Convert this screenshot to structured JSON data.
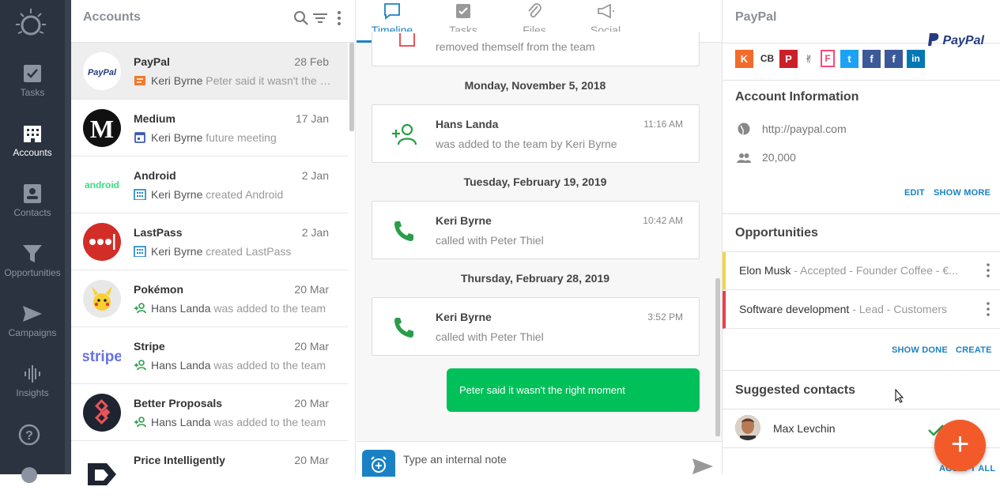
{
  "nav": {
    "items": [
      {
        "label": "Tasks",
        "icon": "checkbox-icon"
      },
      {
        "label": "Accounts",
        "icon": "building-icon"
      },
      {
        "label": "Contacts",
        "icon": "contact-card-icon"
      },
      {
        "label": "Opportunities",
        "icon": "funnel-icon"
      },
      {
        "label": "Campaigns",
        "icon": "paper-plane-icon"
      },
      {
        "label": "Insights",
        "icon": "waveform-icon"
      }
    ]
  },
  "list": {
    "title": "Accounts",
    "rows": [
      {
        "name": "PayPal",
        "date": "28 Feb",
        "who": "Keri Byrne",
        "text": "Peter said it wasn't the right moment",
        "icon": "note-icon"
      },
      {
        "name": "Medium",
        "date": "17 Jan",
        "who": "Keri Byrne",
        "text": "future meeting",
        "icon": "calendar-icon"
      },
      {
        "name": "Android",
        "date": "2 Jan",
        "who": "Keri Byrne",
        "text": "created Android",
        "icon": "building-icon"
      },
      {
        "name": "LastPass",
        "date": "2 Jan",
        "who": "Keri Byrne",
        "text": "created LastPass",
        "icon": "building-icon"
      },
      {
        "name": "Pokémon",
        "date": "20 Mar",
        "who": "Hans Landa",
        "text": "was added to the team",
        "icon": "add-person-icon"
      },
      {
        "name": "Stripe",
        "date": "20 Mar",
        "who": "Hans Landa",
        "text": "was added to the team",
        "icon": "add-person-icon"
      },
      {
        "name": "Better Proposals",
        "date": "20 Mar",
        "who": "Hans Landa",
        "text": "was added to the team",
        "icon": "add-person-icon"
      },
      {
        "name": "Price Intelligently",
        "date": "20 Mar",
        "who": "",
        "text": "",
        "icon": ""
      }
    ],
    "logos": {
      "paypal": "PayPal",
      "medium": "M",
      "android": "android",
      "stripe": "stripe"
    }
  },
  "tabs": [
    {
      "label": "Timeline"
    },
    {
      "label": "Tasks"
    },
    {
      "label": "Files"
    },
    {
      "label": "Social"
    }
  ],
  "timeline": {
    "top_partial": "removed themself from the team",
    "groups": [
      {
        "day": "Monday, November 5, 2018",
        "name": "Hans Landa",
        "time": "11:16 AM",
        "desc": "was added to the team by Keri Byrne"
      },
      {
        "day": "Tuesday, February 19, 2019",
        "name": "Keri Byrne",
        "time": "10:42 AM",
        "desc": "called with Peter Thiel"
      },
      {
        "day": "Thursday, February 28, 2019",
        "name": "Keri Byrne",
        "time": "3:52 PM",
        "desc": "called with Peter Thiel"
      }
    ],
    "bubble": "Peter said it wasn't the right moment",
    "composer_placeholder": "Type an internal note"
  },
  "right": {
    "title": "PayPal",
    "logo_text": "PayPal",
    "account_info_title": "Account Information",
    "website": "http://paypal.com",
    "employees": "20,000",
    "edit": "EDIT",
    "show_more": "SHOW MORE",
    "opportunities_title": "Opportunities",
    "opportunities": [
      {
        "title": "Elon Musk",
        "meta": " - Accepted  - Founder Coffee  - €...",
        "color": "#f5d547"
      },
      {
        "title": "Software development",
        "meta": " - Lead  - Customers",
        "color": "#e8414a"
      }
    ],
    "show_done": "SHOW DONE",
    "create": "CREATE",
    "suggested_title": "Suggested contacts",
    "contact_name": "Max Levchin",
    "accept_all": "ACCEPT ALL"
  },
  "colors": {
    "accent": "#1a82c4",
    "green": "#00c05a",
    "fab": "#f25a2a",
    "nav_bg": "#2b3340"
  }
}
